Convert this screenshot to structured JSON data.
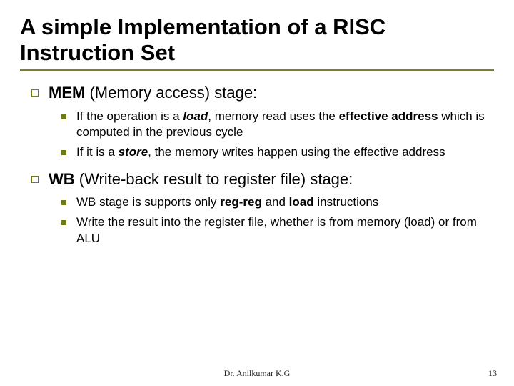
{
  "title": "A simple Implementation of a RISC Instruction Set",
  "sections": [
    {
      "heading_pre": "MEM",
      "heading_rest": " (Memory access) stage:",
      "items": [
        {
          "runs": [
            {
              "t": "If the operation is a ",
              "b": false,
              "i": false
            },
            {
              "t": "load",
              "b": true,
              "i": true
            },
            {
              "t": ", memory read uses the ",
              "b": false,
              "i": false
            },
            {
              "t": "effective address",
              "b": true,
              "i": false
            },
            {
              "t": " which is computed in the previous cycle",
              "b": false,
              "i": false
            }
          ]
        },
        {
          "runs": [
            {
              "t": "If it is a ",
              "b": false,
              "i": false
            },
            {
              "t": "store",
              "b": true,
              "i": true
            },
            {
              "t": ", the memory writes happen using the effective address",
              "b": false,
              "i": false
            }
          ]
        }
      ]
    },
    {
      "heading_pre": "WB",
      "heading_rest": " (Write-back result to register file) stage:",
      "items": [
        {
          "runs": [
            {
              "t": "WB stage is supports only ",
              "b": false,
              "i": false
            },
            {
              "t": "reg-reg",
              "b": true,
              "i": false
            },
            {
              "t": " and ",
              "b": false,
              "i": false
            },
            {
              "t": "load",
              "b": true,
              "i": false
            },
            {
              "t": " instructions",
              "b": false,
              "i": false
            }
          ]
        },
        {
          "runs": [
            {
              "t": "Write the result into the register file, whether is from memory (load) or from ALU",
              "b": false,
              "i": false
            }
          ]
        }
      ]
    }
  ],
  "footer": {
    "author": "Dr. Anilkumar K.G",
    "page": "13"
  }
}
